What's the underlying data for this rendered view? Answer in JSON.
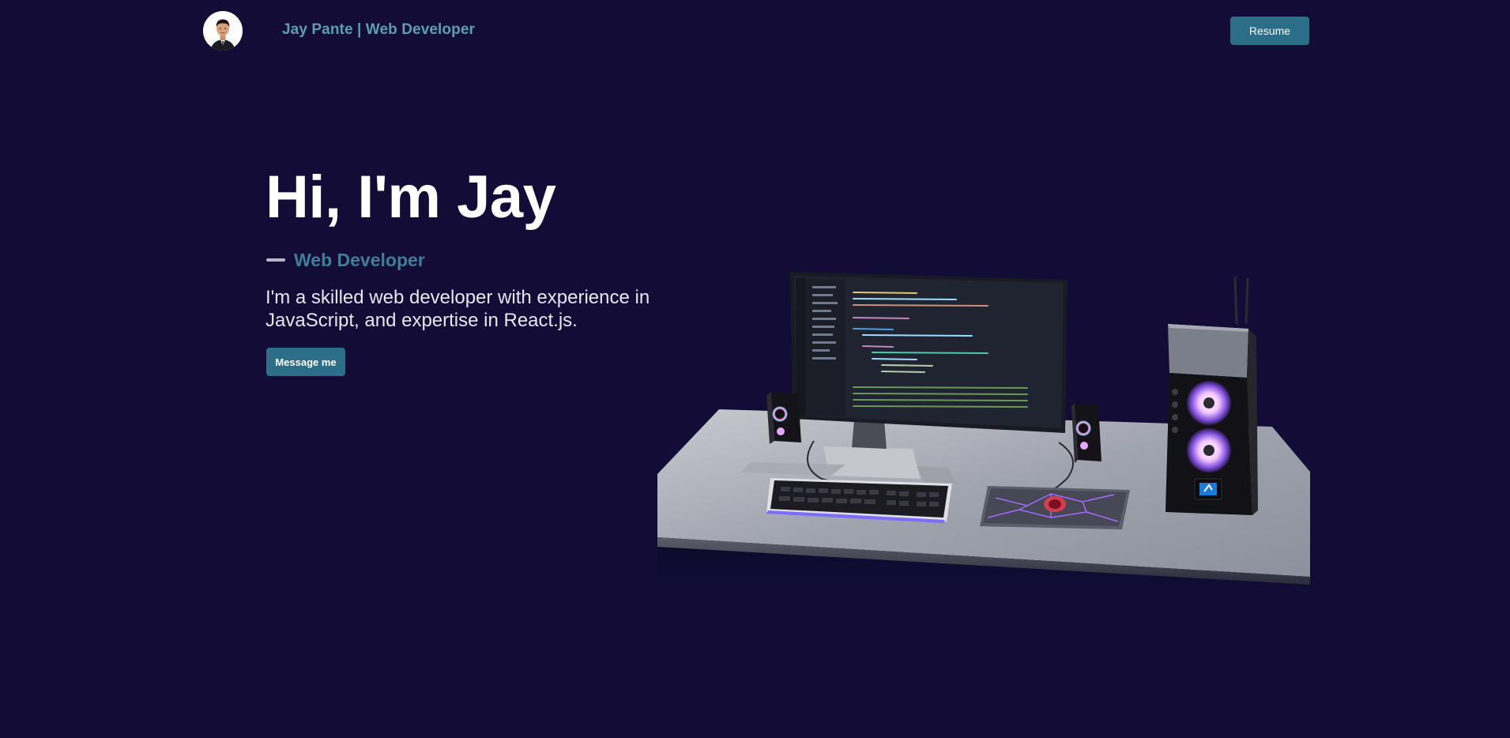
{
  "header": {
    "brand": "Jay Pante | Web Developer",
    "resume_label": "Resume"
  },
  "hero": {
    "title": "Hi, I'm Jay",
    "subtitle": "Web Developer",
    "bio": "I'm a skilled web developer with experience in JavaScript, and expertise in React.js.",
    "message_label": "Message me"
  },
  "colors": {
    "background": "#120c36",
    "accent": "#2c6d87",
    "brand_text": "#5d9fb0",
    "subtitle_text": "#3f7f99"
  },
  "icons": {
    "avatar": "profile-photo",
    "scene": "desk-setup-3d-illustration"
  }
}
